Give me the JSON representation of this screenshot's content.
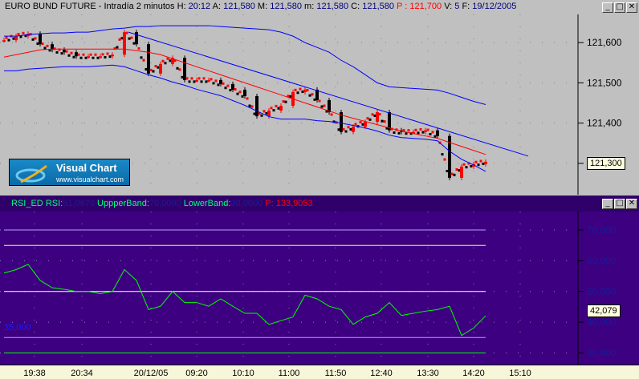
{
  "window": {
    "instrument": "EURO BUND FUTURE - Intradía 2 minutos",
    "h_label": "H:",
    "h": "20:12",
    "a_label": "A:",
    "a": "121,580",
    "m_label": "M:",
    "m": "121,580",
    "mm_label": "m:",
    "mm": "121,580",
    "c_label": "C:",
    "c": "121,580",
    "p_label": "P :",
    "p": "121,700",
    "v_label": "V:",
    "v": "5",
    "f_label": "F:",
    "f": "19/12/2005"
  },
  "buttons": {
    "minimize": "_",
    "maximize": "□",
    "close": "✕"
  },
  "logo": {
    "name": "Visual Chart",
    "url": "www.visualchart.com"
  },
  "rsi": {
    "name": "RSI_ED",
    "rsi_label": "RSI:",
    "rsi_value": "51,0670",
    "upper_label": "UppperBand:",
    "upper_value": "70,0000",
    "lower_label": "LowerBand:",
    "lower_value": "30,0000",
    "p_label": "P:",
    "p_value": "133,9053",
    "left_marker": "35,000"
  },
  "colors": {
    "price_up": "#ff0000",
    "price_down": "#000000",
    "band": "#0000ff",
    "ma": "#ff0000",
    "rsi_line": "#00ff00",
    "rsi_bg": "#3d0080"
  },
  "chart_data": [
    {
      "type": "line",
      "title": "EURO BUND FUTURE - Intradía 2 minutos",
      "y_ticks": [
        "121,600",
        "121,500",
        "121,400",
        "121,300"
      ],
      "y_tick_values": [
        121600,
        121500,
        121400,
        121300
      ],
      "ylim": [
        121228,
        121670
      ],
      "current_label": "121,300",
      "series": [
        {
          "name": "price",
          "values": [
            121606,
            121616,
            121622,
            121596,
            121582,
            121576,
            121566,
            121566,
            121566,
            121570,
            121626,
            121596,
            121523,
            121547,
            121562,
            121507,
            121507,
            121507,
            121497,
            121483,
            121467,
            121417,
            121431,
            121443,
            121477,
            121483,
            121457,
            121427,
            121378,
            121391,
            121403,
            121427,
            121382,
            121378,
            121378,
            121382,
            121368,
            121264,
            121292,
            121298,
            121304
          ]
        },
        {
          "name": "upper-band",
          "values": [
            121616,
            121616,
            121620,
            121622,
            121624,
            121624,
            121626,
            121626,
            121630,
            121634,
            121636,
            121640,
            121640,
            121642,
            121642,
            121642,
            121642,
            121642,
            121640,
            121638,
            121636,
            121634,
            121632,
            121626,
            121616,
            121600,
            121588,
            121576,
            121556,
            121540,
            121520,
            121500,
            121490,
            121488,
            121486,
            121484,
            121482,
            121474,
            121464,
            121454,
            121446
          ]
        },
        {
          "name": "lower-band",
          "values": [
            121530,
            121530,
            121534,
            121536,
            121538,
            121540,
            121540,
            121540,
            121542,
            121544,
            121540,
            121530,
            121520,
            121512,
            121502,
            121494,
            121484,
            121476,
            121468,
            121456,
            121444,
            121430,
            121416,
            121410,
            121410,
            121410,
            121406,
            121404,
            121400,
            121394,
            121388,
            121380,
            121370,
            121364,
            121362,
            121360,
            121356,
            121330,
            121310,
            121296,
            121280
          ]
        },
        {
          "name": "moving-average",
          "values": [
            121564,
            121570,
            121576,
            121582,
            121584,
            121584,
            121584,
            121584,
            121584,
            121584,
            121584,
            121580,
            121576,
            121570,
            121560,
            121550,
            121540,
            121530,
            121520,
            121510,
            121500,
            121490,
            121480,
            121470,
            121460,
            121450,
            121440,
            121430,
            121420,
            121412,
            121404,
            121396,
            121388,
            121380,
            121374,
            121368,
            121362,
            121352,
            121342,
            121332,
            121322
          ]
        }
      ],
      "trendline": [
        [
          121626,
          121318
        ]
      ]
    },
    {
      "type": "line",
      "title": "RSI_ED",
      "y_ticks": [
        "70,000",
        "60,000",
        "50,000",
        "40,000",
        "30,000"
      ],
      "y_tick_values": [
        70,
        60,
        50,
        40,
        30
      ],
      "ylim": [
        27,
        76
      ],
      "current_label": "42,079",
      "levels": [
        70,
        65,
        50,
        35,
        30
      ],
      "series": [
        {
          "name": "rsi",
          "values": [
            56.0,
            57.1,
            58.8,
            53.6,
            51.2,
            50.7,
            50.0,
            50.0,
            49.3,
            50.0,
            57.1,
            53.6,
            44.1,
            45.2,
            50.0,
            46.4,
            46.4,
            45.2,
            47.6,
            45.2,
            42.9,
            42.9,
            39.3,
            40.5,
            41.7,
            48.8,
            47.6,
            45.2,
            44.1,
            39.3,
            41.7,
            42.9,
            46.4,
            42.2,
            42.9,
            43.6,
            44.1,
            45.2,
            35.7,
            38.1,
            42.1
          ]
        }
      ]
    }
  ],
  "time_axis": [
    "19:38",
    "20:34",
    "20/12/05",
    "09:20",
    "10:10",
    "11:00",
    "11:50",
    "12:40",
    "13:30",
    "14:20",
    "15:10"
  ]
}
